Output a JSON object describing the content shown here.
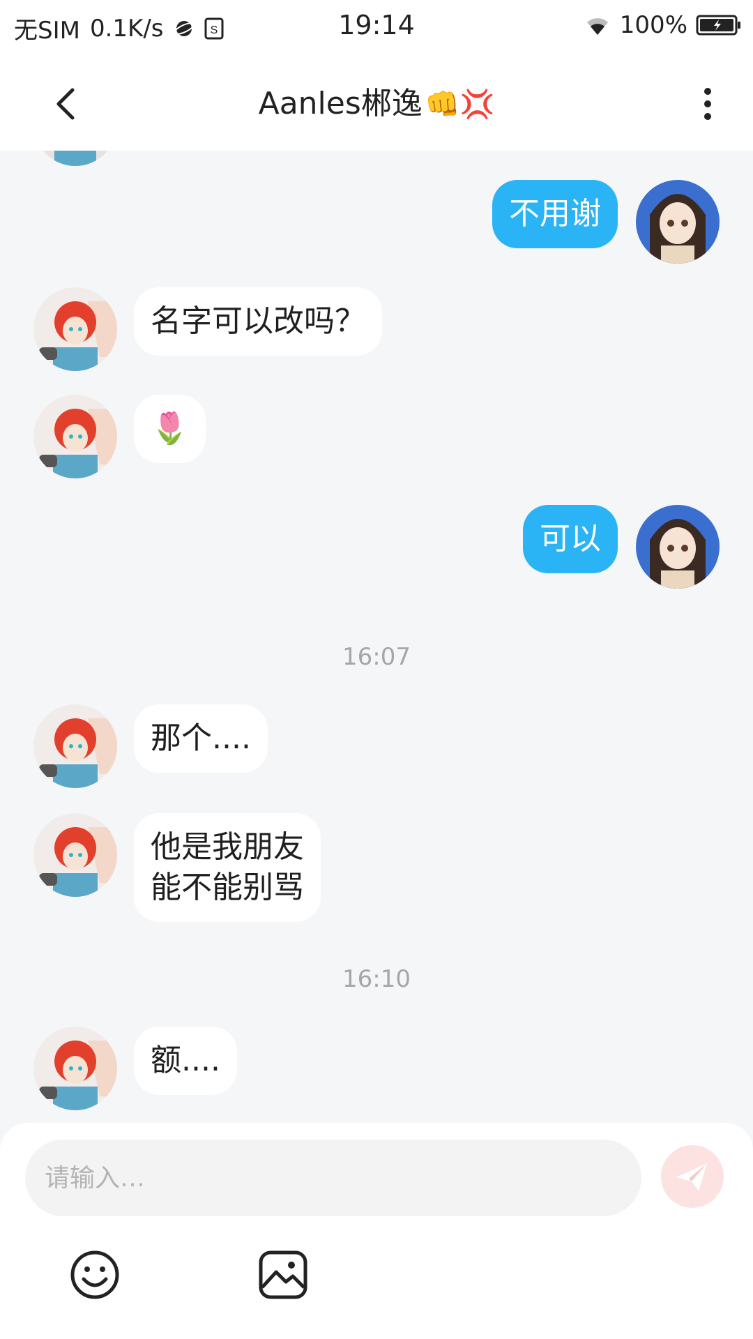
{
  "status_bar": {
    "carrier": "无SIM",
    "speed": "0.1K/s",
    "time": "19:14",
    "battery": "100%"
  },
  "header": {
    "title": "Aanles郴逸",
    "title_emojis": "👊💢"
  },
  "messages": [
    {
      "side": "out",
      "text": "不用谢"
    },
    {
      "side": "in",
      "text": "名字可以改吗？"
    },
    {
      "side": "in",
      "text": "🌷"
    },
    {
      "side": "out",
      "text": "可以"
    },
    {
      "type": "time",
      "text": "16:07"
    },
    {
      "side": "in",
      "text": "那个...."
    },
    {
      "side": "in",
      "text": "他是我朋友\n能不能别骂"
    },
    {
      "type": "time",
      "text": "16:10"
    },
    {
      "side": "in",
      "text": "额...."
    }
  ],
  "composer": {
    "placeholder": "请输入…"
  },
  "colors": {
    "outgoing_bubble": "#2ab3f5",
    "incoming_bubble": "#ffffff",
    "send_button": "#fde2e2",
    "chat_background": "#f5f6f8"
  },
  "icons": {
    "back": "chevron-left-icon",
    "more": "more-vertical-icon",
    "send": "paper-plane-icon",
    "emoji": "smiley-icon",
    "image": "image-icon"
  }
}
